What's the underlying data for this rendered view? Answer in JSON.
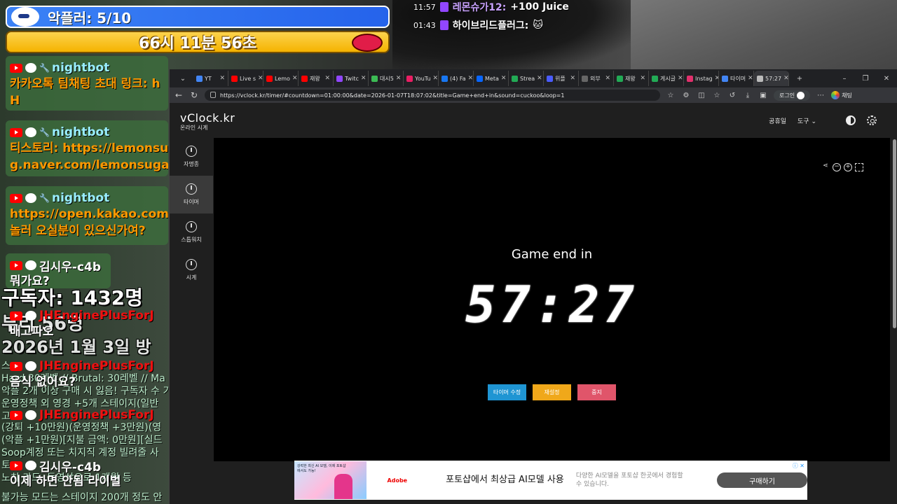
{
  "overlay": {
    "subscriber_goal": "악플러: 5/10",
    "countdown": "66시 11분 56초",
    "subscribers": "구독자: 1432명",
    "line_b": "부리 56명",
    "date": "2026년 1월 3일 방",
    "rule_lines": [
      "스",
      "Hard 30레벨 // Brutal: 30레벨 // Ma",
      "악플 2개 이상 구매 시 잃음! 구독자 수 기준",
      "운영정책 외 영경 +5개 스테이지(일반",
      "고",
      "(강퇴 +10만원)(운영정책 +3만원)(영",
      "(악플 +1만원)[지불 금액: 0만원][실드",
      "Soop계정 또는 치지직 계정 빌려줄 사",
      "토",
      "노치 카드, 동영상으로 1개월 등",
      "불가능 모드는 스테이지 200개 정도 안"
    ]
  },
  "top_right_chat": [
    {
      "time": "11:57",
      "nick": "레몬슈가12:",
      "msg": "+100 Juice"
    },
    {
      "time": "01:43",
      "nick": "하이브리드플러그:",
      "msg": "🐱"
    }
  ],
  "chat": [
    {
      "name": "nightbot",
      "text1": "카카오톡 팀채팅 초대 링크: h",
      "text2": "H"
    },
    {
      "name": "nightbot",
      "text1": "티스토리: https://lemonsuga",
      "text2": "g.naver.com/lemonsugar18"
    },
    {
      "name": "nightbot",
      "text1": "https://open.kakao.com/o/",
      "text2": "놀러 오실분이 있으신가여?"
    },
    {
      "name": "김시우-c4b",
      "text1": "뭐가요?"
    },
    {
      "name": "JHEnginePlusForJ",
      "text1": "배고파오"
    },
    {
      "name": "JHEnginePlusForJ",
      "text1": "음식 없어요?"
    },
    {
      "name": "JHEnginePlusForJ",
      "text1": ""
    },
    {
      "name": "김시우-c4b",
      "text1": "이제 하면 안됨 라이벌"
    }
  ],
  "browser": {
    "tabs": [
      {
        "label": "YT",
        "color": "#4285f4"
      },
      {
        "label": "Live s",
        "color": "#ff0000"
      },
      {
        "label": "Lemo",
        "color": "#ff0000"
      },
      {
        "label": "재왕",
        "color": "#ff0000"
      },
      {
        "label": "Twitc",
        "color": "#9146ff"
      },
      {
        "label": "대시5",
        "color": "#3cba54"
      },
      {
        "label": "YouTu",
        "color": "#e91e63"
      },
      {
        "label": "(4) Fa",
        "color": "#1877f2"
      },
      {
        "label": "Meta",
        "color": "#0866ff"
      },
      {
        "label": "Strea",
        "color": "#22aa55"
      },
      {
        "label": "위플",
        "color": "#4a5cff"
      },
      {
        "label": "외부",
        "color": "#666"
      },
      {
        "label": "재왕",
        "color": "#22aa55"
      },
      {
        "label": "게시글",
        "color": "#22aa55"
      },
      {
        "label": "Instag",
        "color": "#e1306c"
      },
      {
        "label": "타이머",
        "color": "#4285f4"
      },
      {
        "label": "57:27",
        "color": "#bbb"
      }
    ],
    "url": "https://vclock.kr/timer/#countdown=01:00:00&date=2026-01-07T18:07:02&title=Game+end+in&sound=cuckoo&loop=1",
    "login_label": "로그인",
    "chat_label": "채팅"
  },
  "site": {
    "logo": "vClock.kr",
    "logo_sub": "온라인 시계",
    "holidays": "공휴일",
    "tools": "도구",
    "nav": [
      {
        "label": "자명종"
      },
      {
        "label": "타이머"
      },
      {
        "label": "스톱워치"
      },
      {
        "label": "시계"
      }
    ],
    "timer_title": "Game end in",
    "timer_value": "57:27",
    "btn_edit": "타이머 수정",
    "btn_reset": "재설정",
    "btn_stop": "중지"
  },
  "ad": {
    "thumb_text": "강력한 최신 AI 모델, 이제 포토샵에서도 가능!",
    "brand": "Adobe",
    "headline": "포토샵에서 최상급 AI모델 사용",
    "sub": "다양한 AI모델을 포토샵 한곳에서 경험할 수 있습니다.",
    "cta": "구매하기"
  }
}
